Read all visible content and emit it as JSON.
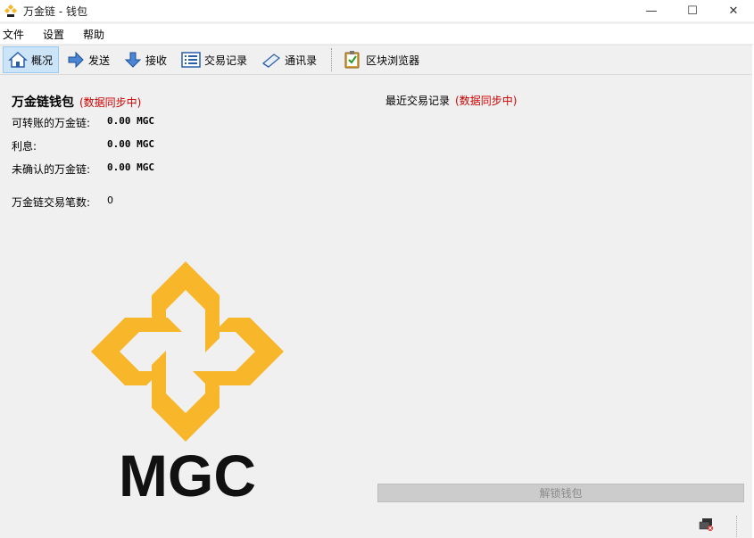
{
  "window": {
    "title": "万金链 - 钱包",
    "minimize_glyph": "—",
    "maximize_glyph": "☐",
    "close_glyph": "✕"
  },
  "menu": {
    "file": "文件",
    "settings": "设置",
    "help": "帮助"
  },
  "toolbar": {
    "overview": "概况",
    "send": "发送",
    "receive": "接收",
    "transactions": "交易记录",
    "address_book": "通讯录",
    "block_explorer": "区块浏览器"
  },
  "wallet": {
    "title": "万金链钱包",
    "sync_status": "(数据同步中)",
    "transferable_label": "可转账的万金链:",
    "transferable_value": "0.00 MGC",
    "interest_label": "利息:",
    "interest_value": "0.00 MGC",
    "unconfirmed_label": "未确认的万金链:",
    "unconfirmed_value": "0.00 MGC",
    "tx_count_label": "万金链交易笔数:",
    "tx_count_value": "0"
  },
  "recent": {
    "title": "最近交易记录",
    "sync_status": "(数据同步中)"
  },
  "logo": {
    "text": "MGC",
    "accent_color": "#f8b62b"
  },
  "unlock_button": "解锁钱包",
  "colors": {
    "sync_red": "#cc0000",
    "active_tab": "#cce4f7"
  }
}
